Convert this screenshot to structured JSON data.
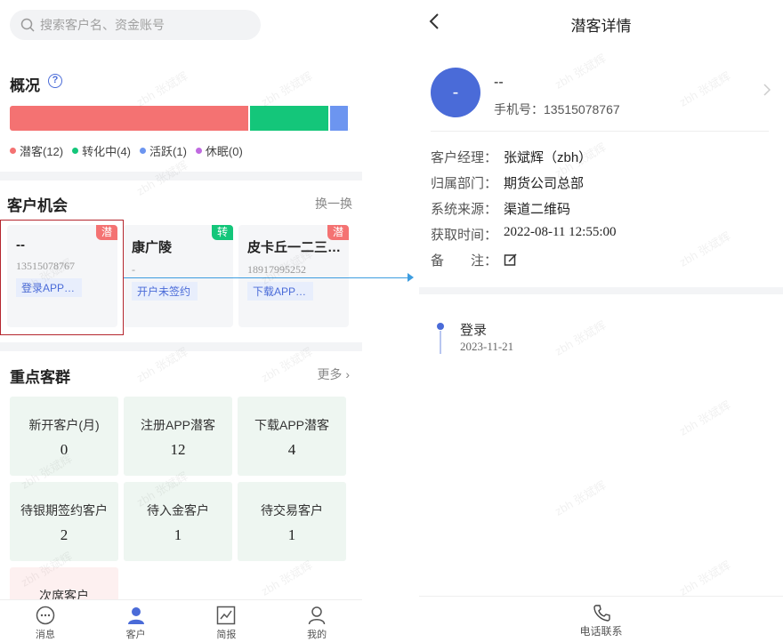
{
  "search": {
    "placeholder": "搜索客户名、资金账号"
  },
  "overview": {
    "title": "概况",
    "segments": [
      {
        "label": "潜客",
        "count": 12,
        "color": "#f47272"
      },
      {
        "label": "转化中",
        "count": 4,
        "color": "#14c67a"
      },
      {
        "label": "活跃",
        "count": 1,
        "color": "#6c95f0"
      },
      {
        "label": "休眠",
        "count": 0,
        "color": "#c06ae0"
      }
    ],
    "legend_text": [
      "潜客(12)",
      "转化中(4)",
      "活跃(1)",
      "休眠(0)"
    ]
  },
  "opportunities": {
    "title": "客户机会",
    "action": "换一换",
    "items": [
      {
        "name": "--",
        "phone": "13515078767",
        "status": "登录APP…",
        "tag": "潜",
        "tag_color": "#f47272"
      },
      {
        "name": "康广陵",
        "phone": "-",
        "status": "开户未签约",
        "tag": "转",
        "tag_color": "#14c67a"
      },
      {
        "name": "皮卡丘一二三…",
        "phone": "18917995252",
        "status": "下载APP…",
        "tag": "潜",
        "tag_color": "#f47272"
      }
    ]
  },
  "groups": {
    "title": "重点客群",
    "action": "更多",
    "cards": [
      {
        "label": "新开客户(月)",
        "value": "0"
      },
      {
        "label": "注册APP潜客",
        "value": "12"
      },
      {
        "label": "下载APP潜客",
        "value": "4"
      },
      {
        "label": "待银期签约客户",
        "value": "2"
      },
      {
        "label": "待入金客户",
        "value": "1"
      },
      {
        "label": "待交易客户",
        "value": "1"
      },
      {
        "label": "次席客户",
        "value": ""
      }
    ]
  },
  "tabbar": [
    {
      "label": "消息",
      "icon": "message-icon"
    },
    {
      "label": "客户",
      "icon": "customer-icon"
    },
    {
      "label": "简报",
      "icon": "chart-icon"
    },
    {
      "label": "我的",
      "icon": "profile-icon"
    }
  ],
  "detail": {
    "title": "潜客详情",
    "avatar_text": "-",
    "name": "--",
    "phone_label": "手机号：13515078767",
    "fields": [
      {
        "key": "客户经理：",
        "value": "张斌辉（zbh）"
      },
      {
        "key": "归属部门：",
        "value": "期货公司总部"
      },
      {
        "key": "系统来源：",
        "value": "渠道二维码"
      },
      {
        "key": "获取时间：",
        "value": "2022-08-11 12:55:00"
      },
      {
        "key": "备　　注：",
        "value": ""
      }
    ],
    "timeline": [
      {
        "event": "登录",
        "date": "2023-11-21"
      }
    ],
    "call_label": "电话联系"
  },
  "watermark": "zbh 张斌辉",
  "colors": {
    "accent": "#4a6bd8",
    "highlight": "#b5262e",
    "connector": "#3d9de0"
  }
}
